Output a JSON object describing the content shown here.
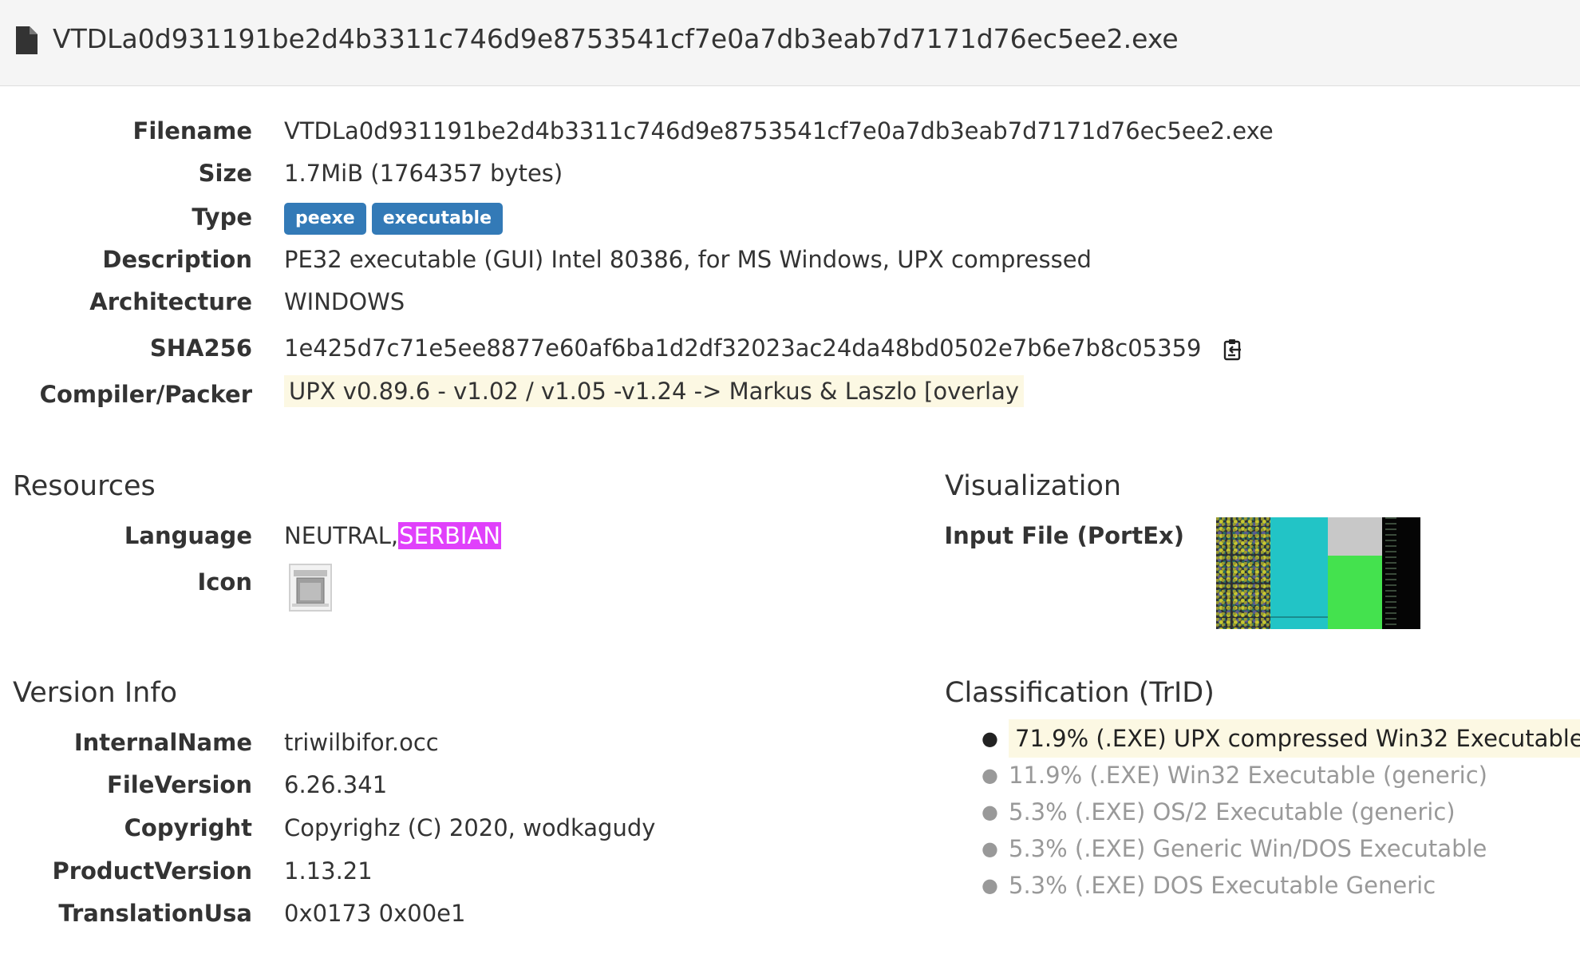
{
  "header": {
    "file_icon": "file-icon",
    "title": "VTDLa0d931191be2d4b3311c746d9e8753541cf7e0a7db3eab7d7171d76ec5ee2.exe"
  },
  "details": {
    "filename_label": "Filename",
    "filename": "VTDLa0d931191be2d4b3311c746d9e8753541cf7e0a7db3eab7d7171d76ec5ee2.exe",
    "size_label": "Size",
    "size": "1.7MiB (1764357 bytes)",
    "type_label": "Type",
    "types": [
      "peexe",
      "executable"
    ],
    "description_label": "Description",
    "description": "PE32 executable (GUI) Intel 80386, for MS Windows, UPX compressed",
    "architecture_label": "Architecture",
    "architecture": "WINDOWS",
    "sha256_label": "SHA256",
    "sha256": "1e425d7c71e5ee8877e60af6ba1d2df32023ac24da48bd0502e7b6e7b8c05359",
    "copy_icon": "clipboard-icon",
    "packer_label": "Compiler/Packer",
    "packer": "UPX v0.89.6 - v1.02 / v1.05 -v1.24 -> Markus & Laszlo [overlay"
  },
  "resources": {
    "title": "Resources",
    "language_label": "Language",
    "language_neutral": "NEUTRAL,",
    "language_highlight": "SERBIAN",
    "icon_label": "Icon",
    "icon_name": "resource-icon-thumbnail"
  },
  "visualization": {
    "title": "Visualization",
    "input_label": "Input File (PortEx)"
  },
  "version_info": {
    "title": "Version Info",
    "internalname_label": "InternalName",
    "internalname": "triwilbifor.occ",
    "fileversion_label": "FileVersion",
    "fileversion": "6.26.341",
    "copyright_label": "Copyright",
    "copyright": "Copyrighz (C) 2020, wodkagudy",
    "productversion_label": "ProductVersion",
    "productversion": "1.13.21",
    "translation_label": "TranslationUsa",
    "translation": "0x0173 0x00e1"
  },
  "classification": {
    "title": "Classification (TrID)",
    "items": [
      "71.9% (.EXE) UPX compressed Win32 Executable",
      "11.9% (.EXE) Win32 Executable (generic)",
      "5.3% (.EXE) OS/2 Executable (generic)",
      "5.3% (.EXE) Generic Win/DOS Executable",
      "5.3% (.EXE) DOS Executable Generic"
    ]
  },
  "colors": {
    "badge": "#337ab7",
    "warning_highlight": "#fcf8e3",
    "language_highlight": "#e040fb"
  }
}
